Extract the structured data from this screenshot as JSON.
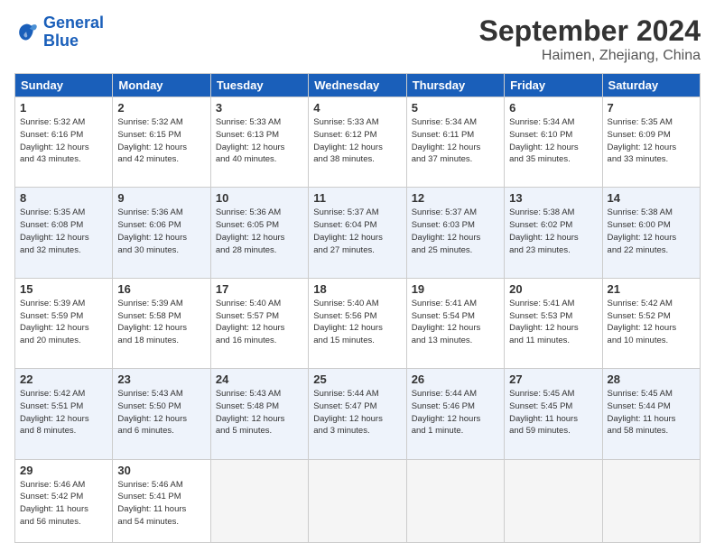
{
  "logo": {
    "line1": "General",
    "line2": "Blue"
  },
  "title": "September 2024",
  "location": "Haimen, Zhejiang, China",
  "headers": [
    "Sunday",
    "Monday",
    "Tuesday",
    "Wednesday",
    "Thursday",
    "Friday",
    "Saturday"
  ],
  "weeks": [
    [
      {
        "day": "1",
        "info": "Sunrise: 5:32 AM\nSunset: 6:16 PM\nDaylight: 12 hours\nand 43 minutes."
      },
      {
        "day": "2",
        "info": "Sunrise: 5:32 AM\nSunset: 6:15 PM\nDaylight: 12 hours\nand 42 minutes."
      },
      {
        "day": "3",
        "info": "Sunrise: 5:33 AM\nSunset: 6:13 PM\nDaylight: 12 hours\nand 40 minutes."
      },
      {
        "day": "4",
        "info": "Sunrise: 5:33 AM\nSunset: 6:12 PM\nDaylight: 12 hours\nand 38 minutes."
      },
      {
        "day": "5",
        "info": "Sunrise: 5:34 AM\nSunset: 6:11 PM\nDaylight: 12 hours\nand 37 minutes."
      },
      {
        "day": "6",
        "info": "Sunrise: 5:34 AM\nSunset: 6:10 PM\nDaylight: 12 hours\nand 35 minutes."
      },
      {
        "day": "7",
        "info": "Sunrise: 5:35 AM\nSunset: 6:09 PM\nDaylight: 12 hours\nand 33 minutes."
      }
    ],
    [
      {
        "day": "8",
        "info": "Sunrise: 5:35 AM\nSunset: 6:08 PM\nDaylight: 12 hours\nand 32 minutes."
      },
      {
        "day": "9",
        "info": "Sunrise: 5:36 AM\nSunset: 6:06 PM\nDaylight: 12 hours\nand 30 minutes."
      },
      {
        "day": "10",
        "info": "Sunrise: 5:36 AM\nSunset: 6:05 PM\nDaylight: 12 hours\nand 28 minutes."
      },
      {
        "day": "11",
        "info": "Sunrise: 5:37 AM\nSunset: 6:04 PM\nDaylight: 12 hours\nand 27 minutes."
      },
      {
        "day": "12",
        "info": "Sunrise: 5:37 AM\nSunset: 6:03 PM\nDaylight: 12 hours\nand 25 minutes."
      },
      {
        "day": "13",
        "info": "Sunrise: 5:38 AM\nSunset: 6:02 PM\nDaylight: 12 hours\nand 23 minutes."
      },
      {
        "day": "14",
        "info": "Sunrise: 5:38 AM\nSunset: 6:00 PM\nDaylight: 12 hours\nand 22 minutes."
      }
    ],
    [
      {
        "day": "15",
        "info": "Sunrise: 5:39 AM\nSunset: 5:59 PM\nDaylight: 12 hours\nand 20 minutes."
      },
      {
        "day": "16",
        "info": "Sunrise: 5:39 AM\nSunset: 5:58 PM\nDaylight: 12 hours\nand 18 minutes."
      },
      {
        "day": "17",
        "info": "Sunrise: 5:40 AM\nSunset: 5:57 PM\nDaylight: 12 hours\nand 16 minutes."
      },
      {
        "day": "18",
        "info": "Sunrise: 5:40 AM\nSunset: 5:56 PM\nDaylight: 12 hours\nand 15 minutes."
      },
      {
        "day": "19",
        "info": "Sunrise: 5:41 AM\nSunset: 5:54 PM\nDaylight: 12 hours\nand 13 minutes."
      },
      {
        "day": "20",
        "info": "Sunrise: 5:41 AM\nSunset: 5:53 PM\nDaylight: 12 hours\nand 11 minutes."
      },
      {
        "day": "21",
        "info": "Sunrise: 5:42 AM\nSunset: 5:52 PM\nDaylight: 12 hours\nand 10 minutes."
      }
    ],
    [
      {
        "day": "22",
        "info": "Sunrise: 5:42 AM\nSunset: 5:51 PM\nDaylight: 12 hours\nand 8 minutes."
      },
      {
        "day": "23",
        "info": "Sunrise: 5:43 AM\nSunset: 5:50 PM\nDaylight: 12 hours\nand 6 minutes."
      },
      {
        "day": "24",
        "info": "Sunrise: 5:43 AM\nSunset: 5:48 PM\nDaylight: 12 hours\nand 5 minutes."
      },
      {
        "day": "25",
        "info": "Sunrise: 5:44 AM\nSunset: 5:47 PM\nDaylight: 12 hours\nand 3 minutes."
      },
      {
        "day": "26",
        "info": "Sunrise: 5:44 AM\nSunset: 5:46 PM\nDaylight: 12 hours\nand 1 minute."
      },
      {
        "day": "27",
        "info": "Sunrise: 5:45 AM\nSunset: 5:45 PM\nDaylight: 11 hours\nand 59 minutes."
      },
      {
        "day": "28",
        "info": "Sunrise: 5:45 AM\nSunset: 5:44 PM\nDaylight: 11 hours\nand 58 minutes."
      }
    ],
    [
      {
        "day": "29",
        "info": "Sunrise: 5:46 AM\nSunset: 5:42 PM\nDaylight: 11 hours\nand 56 minutes."
      },
      {
        "day": "30",
        "info": "Sunrise: 5:46 AM\nSunset: 5:41 PM\nDaylight: 11 hours\nand 54 minutes."
      },
      {
        "day": "",
        "info": ""
      },
      {
        "day": "",
        "info": ""
      },
      {
        "day": "",
        "info": ""
      },
      {
        "day": "",
        "info": ""
      },
      {
        "day": "",
        "info": ""
      }
    ]
  ]
}
